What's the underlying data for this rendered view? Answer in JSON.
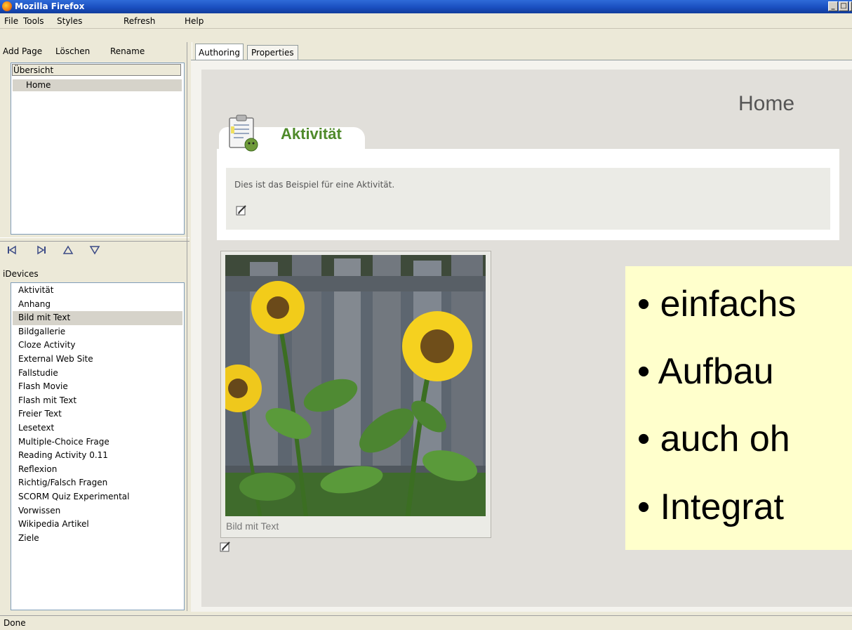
{
  "window": {
    "title": "Mozilla Firefox"
  },
  "menu": [
    "File",
    "Tools",
    "Styles",
    "Refresh",
    "Help"
  ],
  "left_toolbar": {
    "add_page": "Add Page",
    "delete": "Löschen",
    "rename": "Rename"
  },
  "pages": {
    "overview": "Übersicht",
    "home": "Home"
  },
  "nav_icons": [
    "skip-start-icon",
    "skip-end-icon",
    "move-up-icon",
    "move-down-icon"
  ],
  "idevices": {
    "label": "iDevices",
    "items": [
      "Aktivität",
      "Anhang",
      "Bild mit Text",
      "Bildgallerie",
      "Cloze Activity",
      "External Web Site",
      "Fallstudie",
      "Flash Movie",
      "Flash mit Text",
      "Freier Text",
      "Lesetext",
      "Multiple-Choice Frage",
      "Reading Activity 0.11",
      "Reflexion",
      "Richtig/Falsch Fragen",
      "SCORM Quiz Experimental",
      "Vorwissen",
      "Wikipedia Artikel",
      "Ziele"
    ],
    "selected": "Bild mit Text"
  },
  "tabs": {
    "authoring": "Authoring",
    "properties": "Properties"
  },
  "content": {
    "page_title": "Home",
    "activity": {
      "heading": "Aktivität",
      "text": "Dies ist das Beispiel für eine Aktivität."
    },
    "image": {
      "caption": "Bild mit Text"
    }
  },
  "overlay": {
    "bullets": [
      "• einfachs",
      "• Aufbau",
      "• auch oh",
      "• Integrat"
    ]
  },
  "status": {
    "text": "Done"
  },
  "colors": {
    "titlebar": "#1a4fc0",
    "activity_green": "#4f8a2a",
    "overlay_bg": "#ffffcc"
  }
}
